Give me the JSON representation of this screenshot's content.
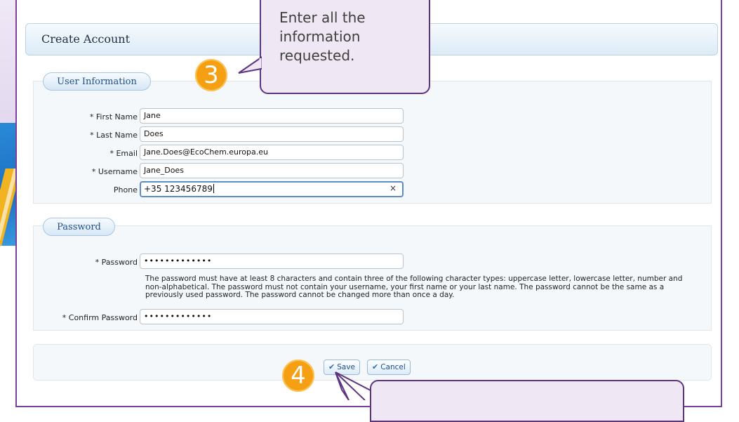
{
  "form": {
    "title": "Create Account",
    "user_section": {
      "legend": "User Information",
      "fields": [
        {
          "label": "* First Name",
          "value": "Jane"
        },
        {
          "label": "* Last Name",
          "value": "Does"
        },
        {
          "label": "* Email",
          "value": "Jane.Does@EcoChem.europa.eu"
        },
        {
          "label": "* Username",
          "value": "Jane_Does"
        },
        {
          "label": "Phone",
          "value": "+35 123456789"
        }
      ]
    },
    "password_section": {
      "legend": "Password",
      "password_label": "* Password",
      "password_value": "•••••••••••••",
      "help": "The password must have at least 8 characters and contain three of the following character types: uppercase letter, lowercase letter, number and non-alphabetical. The password must not contain your username, your first name or your last name. The password cannot be the same as a previously used password. The password cannot be changed more than once a day.",
      "confirm_label": "* Confirm Password",
      "confirm_value": "•••••••••••••"
    },
    "buttons": {
      "save": "Save",
      "cancel": "Cancel"
    }
  },
  "callouts": {
    "step3_number": "3",
    "step3_text": "Enter all the information requested.",
    "step4_number": "4"
  },
  "colors": {
    "badge": "#f59f12",
    "callout_border": "#5d3480",
    "callout_fill": "#efe7f4",
    "frame": "#7b3fa0"
  },
  "icons": {
    "clear": "×",
    "check": "✔"
  }
}
